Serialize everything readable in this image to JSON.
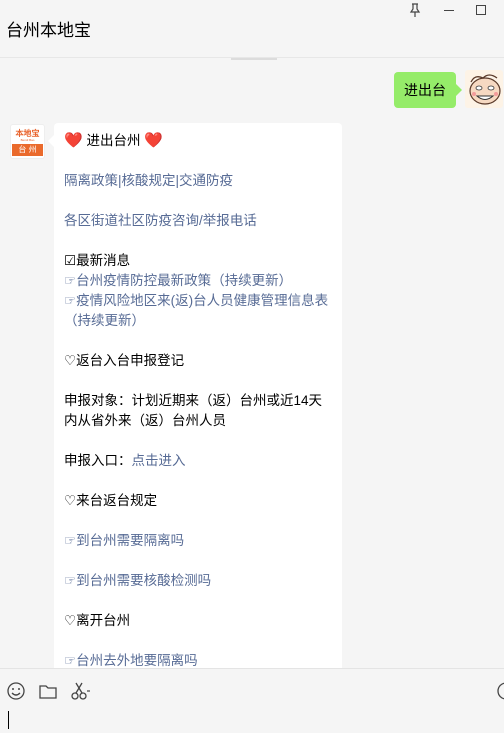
{
  "window": {
    "title": "台州本地宝",
    "pin_icon": "pin-icon",
    "minimize_icon": "minimize-icon",
    "maximize_icon": "maximize-icon"
  },
  "messages": {
    "sent": {
      "text": "进出台"
    },
    "received": {
      "avatar": {
        "logo_text": "本地宝",
        "logo_sub": "Bendi Bao",
        "city": "台 州"
      },
      "heading": "进出台州",
      "nav_links": "隔离政策|核酸规定|交通防疫",
      "consult_link": "各区街道社区防疫咨询/举报电话",
      "latest_label": "☑最新消息",
      "latest_items": [
        "台州疫情防控最新政策（持续更新）",
        "疫情风险地区来(返)台人员健康管理信息表（持续更新）"
      ],
      "return_section": "♡返台入台申报登记",
      "target_label": "申报对象：",
      "target_text": "计划近期来（返）台州或近14天内从省外来（返）台州人员",
      "entry_label": "申报入口：",
      "entry_link": "点击进入",
      "rules_section": "♡来台返台规定",
      "rule_link_1": "到台州需要隔离吗",
      "rule_link_2": "到台州需要核酸检测吗",
      "leave_section": "♡离开台州",
      "leave_link": "台州去外地要隔离吗",
      "hand_glyph": "☞",
      "heart_glyph": "❤️"
    }
  },
  "toolbar": {
    "icons": [
      "emoji-icon",
      "folder-icon",
      "scissors-icon",
      "more-icon"
    ]
  },
  "colors": {
    "sent_bubble": "#95ec69",
    "link": "#576b95",
    "heart": "#d7262c",
    "brand_orange": "#ea6a2c"
  }
}
